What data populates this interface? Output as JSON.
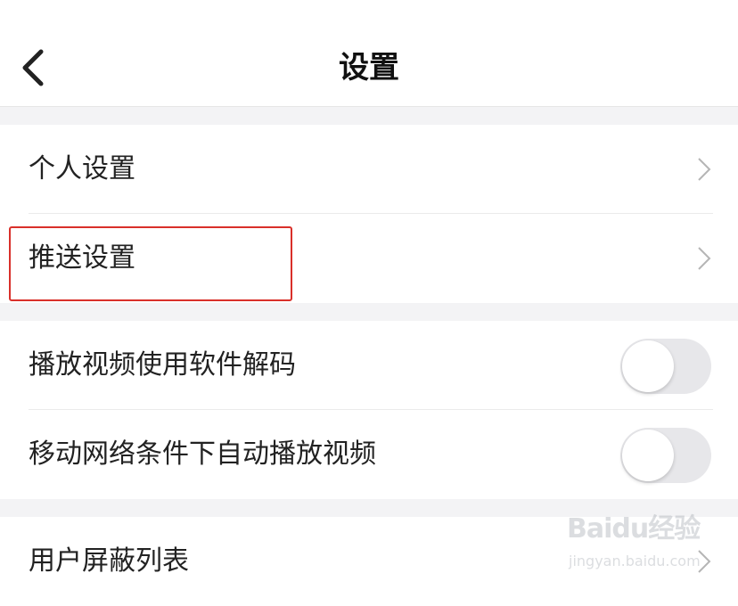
{
  "header": {
    "title": "设置"
  },
  "groups": [
    {
      "rows": [
        {
          "label": "个人设置",
          "control": "chevron"
        },
        {
          "label": "推送设置",
          "control": "chevron",
          "highlighted": true
        }
      ]
    },
    {
      "rows": [
        {
          "label": "播放视频使用软件解码",
          "control": "toggle",
          "on": false
        },
        {
          "label": "移动网络条件下自动播放视频",
          "control": "toggle",
          "on": false
        }
      ]
    },
    {
      "rows": [
        {
          "label": "用户屏蔽列表",
          "control": "chevron"
        }
      ]
    }
  ],
  "watermark": {
    "brand": "Baidu经验",
    "url": "jingyan.baidu.com"
  },
  "colors": {
    "background": "#f3f3f5",
    "surface": "#ffffff",
    "highlight_border": "#d9302a",
    "toggle_off": "#e7e7ea"
  }
}
